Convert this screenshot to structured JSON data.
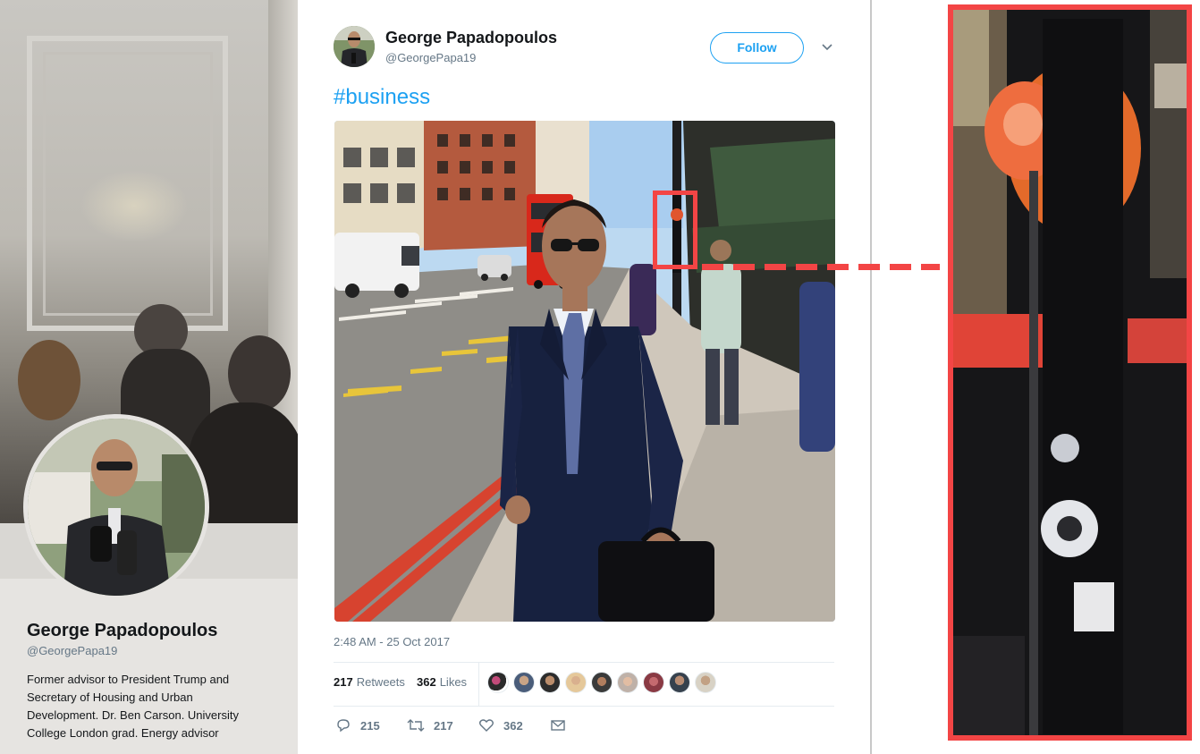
{
  "profile": {
    "name": "George Papadopoulos",
    "handle": "@GeorgePapa19",
    "bio": "Former advisor to President Trump and Secretary of Housing and Urban Development. Dr. Ben Carson. University College London grad. Energy advisor"
  },
  "tweet": {
    "author_name": "George Papadopoulos",
    "author_handle": "@GeorgePapa19",
    "follow_label": "Follow",
    "text": "#business",
    "timestamp": "2:48 AM - 25 Oct 2017",
    "retweets_count": "217",
    "retweets_label": "Retweets",
    "likes_count": "362",
    "likes_label": "Likes",
    "actions": {
      "replies": "215",
      "retweets": "217",
      "likes": "362"
    },
    "likers_count": 9
  },
  "colors": {
    "accent": "#1da1f2",
    "annotation": "#f34545"
  },
  "icons": [
    "chevron-down-icon",
    "reply-icon",
    "retweet-icon",
    "like-icon",
    "message-icon"
  ]
}
